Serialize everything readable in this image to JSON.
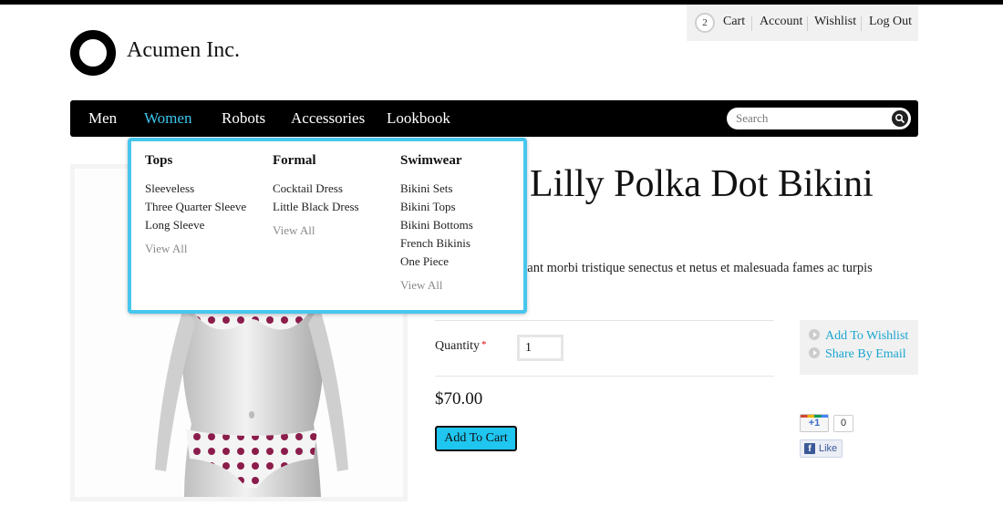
{
  "utility_nav": {
    "cart_count": "2",
    "cart": "Cart",
    "account": "Account",
    "wishlist": "Wishlist",
    "logout": "Log Out"
  },
  "brand": {
    "name": "Acumen Inc."
  },
  "main_nav": {
    "items": [
      "Men",
      "Women",
      "Robots",
      "Accessories",
      "Lookbook"
    ],
    "active": "Women",
    "active_color": "#3cc5ee"
  },
  "search": {
    "placeholder": "Search",
    "value": ""
  },
  "dropdown": {
    "columns": [
      {
        "heading": "Tops",
        "items": [
          "Sleeveless",
          "Three Quarter Sleeve",
          "Long Sleeve"
        ],
        "view_all": "View All"
      },
      {
        "heading": "Formal",
        "items": [
          "Cocktail Dress",
          "Little Black Dress"
        ],
        "view_all": "View All"
      },
      {
        "heading": "Swimwear",
        "items": [
          "Bikini Sets",
          "Bikini Tops",
          "Bikini Bottoms",
          "French Bikinis",
          "One Piece"
        ],
        "view_all": "View All"
      }
    ],
    "border_color": "#47c6ee"
  },
  "product": {
    "title": "Lilly Polka Dot Bikini",
    "description": "bitant morbi tristique senectus et netus et malesuada fames ac turpis",
    "quantity_label": "Quantity",
    "required_mark": "*",
    "quantity_value": "1",
    "price": "$70.00",
    "add_to_cart": "Add To Cart",
    "button_color": "#1fc6f0"
  },
  "side_actions": {
    "wishlist": "Add To Wishlist",
    "share": "Share By Email",
    "link_color": "#1ba6cf"
  },
  "social": {
    "gplus_label": "+1",
    "gplus_count": "0",
    "fb_icon": "f",
    "fb_like": "Like"
  },
  "icons": [
    "search-icon",
    "play-circle-icon",
    "facebook-icon",
    "google-plus-icon",
    "logo-ring-icon"
  ]
}
